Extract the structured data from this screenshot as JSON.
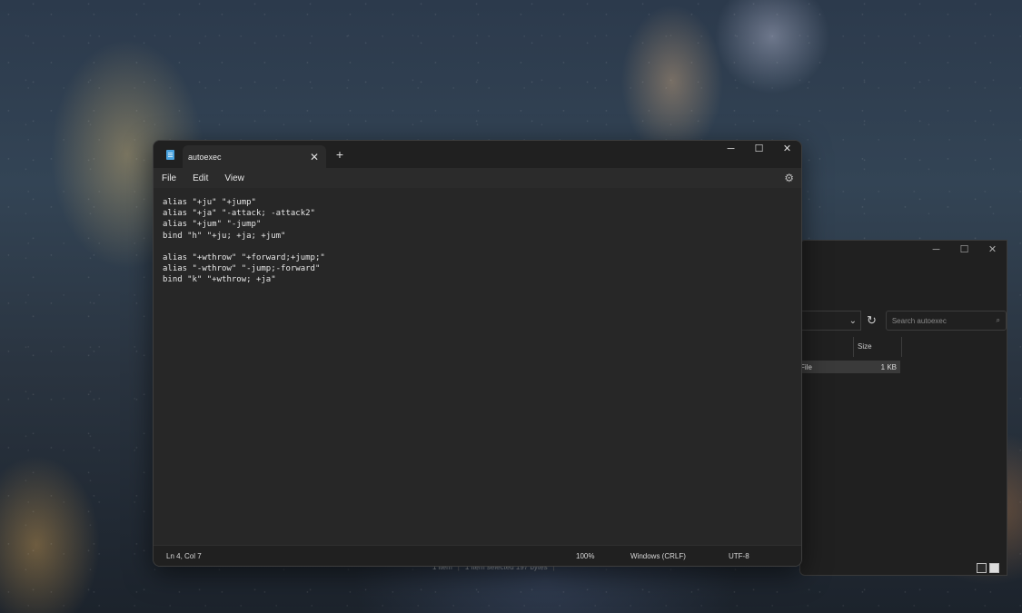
{
  "explorer": {
    "window_controls": {
      "minimize": "─",
      "maximize": "☐",
      "close": "✕"
    },
    "search_placeholder": "Search autoexec",
    "columns": {
      "size": "Size"
    },
    "file": {
      "type": "File",
      "size": "1 KB"
    },
    "status": {
      "items": "1 item",
      "selected": "1 item selected  197 bytes"
    }
  },
  "notepad": {
    "tab_title": "autoexec",
    "tab_close": "✕",
    "new_tab": "+",
    "window_controls": {
      "minimize": "─",
      "maximize": "☐",
      "close": "✕"
    },
    "menu": [
      "File",
      "Edit",
      "View"
    ],
    "settings_glyph": "⚙",
    "lines": [
      "alias \"+ju\" \"+jump\"",
      "alias \"+ja\" \"-attack; -attack2\"",
      "alias \"+jum\" \"-jump\"",
      "bind \"h\" \"+ju; +ja; +jum\"",
      "",
      "alias \"+wthrow\" \"+forward;+jump;\"",
      "alias \"-wthrow\" \"-jump;-forward\"",
      "bind \"k\" \"+wthrow; +ja\""
    ],
    "status": {
      "position": "Ln 4, Col 7",
      "zoom": "100%",
      "line_ending": "Windows (CRLF)",
      "encoding": "UTF-8"
    }
  }
}
